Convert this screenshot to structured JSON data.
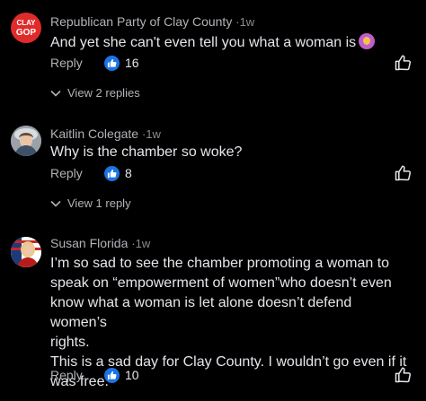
{
  "colors": {
    "background": "#000000",
    "like_blue": "#1b74e4",
    "clay_red": "#e02b2b"
  },
  "comments": [
    {
      "avatar_text": [
        "CLAY",
        "GOP"
      ],
      "author": "Republican Party of Clay County",
      "separator": "·",
      "time": "1w",
      "text": "And yet she can't even tell you what a woman is",
      "emoji": "woman-shrugging-emoji",
      "reply_label": "Reply",
      "reaction_icon": "thumbs-up-icon",
      "reaction_count": "16",
      "view_replies": "View 2 replies"
    },
    {
      "author": "Kaitlin Colegate",
      "separator": "·",
      "time": "1w",
      "text": "Why is the chamber so woke?",
      "reply_label": "Reply",
      "reaction_icon": "thumbs-up-icon",
      "reaction_count": "8",
      "view_replies": "View 1 reply"
    },
    {
      "author": "Susan Florida",
      "separator": "·",
      "time": "1w",
      "text_lines": [
        "I’m so sad to see the chamber promoting a woman to",
        "speak on “empowerment of women”who doesn’t even",
        "know what a woman is let alone doesn’t defend women’s",
        "rights.",
        "This is a sad day for Clay County. I wouldn’t go even if it",
        "was free."
      ],
      "reply_label": "Reply",
      "reaction_icon": "thumbs-up-icon",
      "reaction_count": "10"
    }
  ]
}
